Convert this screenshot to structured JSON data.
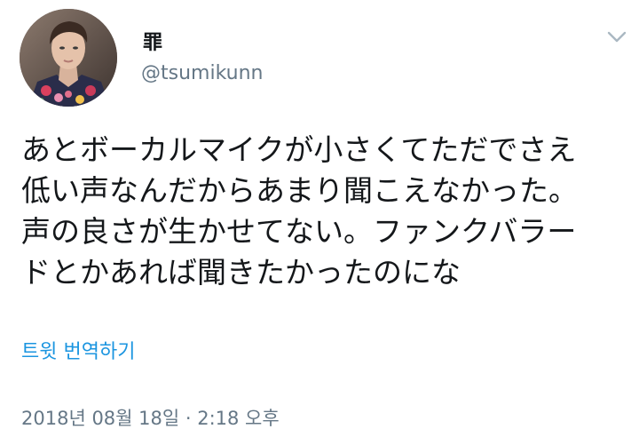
{
  "tweet": {
    "display_name": "罪",
    "handle": "@tsumikunn",
    "body_lines": [
      "あとボーカルマイクが小さくてただでさえ",
      "低い声なんだからあまり聞こえなかった。",
      "声の良さが生かせてない。ファンクバラー",
      "ドとかあれば聞きたかったのにな"
    ],
    "translate_label": "트윗 번역하기",
    "timestamp": "2018년 08월 18일 · 2:18 오후"
  },
  "icons": {
    "menu": "chevron-down-icon",
    "avatar": "avatar-image"
  },
  "colors": {
    "text_primary": "#14171a",
    "text_secondary": "#657786",
    "link": "#1b95e0",
    "chevron": "#aab8c2"
  }
}
